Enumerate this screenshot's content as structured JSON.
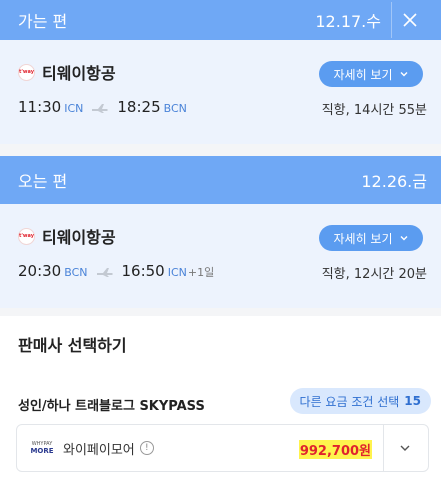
{
  "outbound": {
    "label": "가는 편",
    "date": "12.17.수",
    "airline": "티웨이항공",
    "logo_text": "t'way",
    "detail_label": "자세히 보기",
    "depart_time": "11:30",
    "depart_code": "ICN",
    "arrive_time": "18:25",
    "arrive_code": "BCN",
    "duration": "직항, 14시간 55분"
  },
  "inbound": {
    "label": "오는 편",
    "date": "12.26.금",
    "airline": "티웨이항공",
    "logo_text": "t'way",
    "detail_label": "자세히 보기",
    "depart_time": "20:30",
    "depart_code": "BCN",
    "arrive_time": "16:50",
    "arrive_code": "ICN",
    "day_offset": "+1일",
    "duration": "직항, 12시간 20분"
  },
  "sellers": {
    "title": "판매사 선택하기",
    "fare_name": "성인/하나 트래블로그 SKYPASS",
    "fare_button": "다른 요금 조건 선택",
    "fare_count": "15",
    "items": [
      {
        "logo_top": "WHYPAY",
        "logo_bottom": "MORE",
        "name": "와이페이모어",
        "price": "992,700원"
      }
    ]
  },
  "colors": {
    "band": "#6fa8f5",
    "card_bg": "#edf3fd",
    "accent": "#5b9cf0",
    "price": "#e0222d",
    "highlight": "#fff34d"
  },
  "icons": [
    "close-icon",
    "chevron-down-icon",
    "plane-icon",
    "info-icon"
  ]
}
